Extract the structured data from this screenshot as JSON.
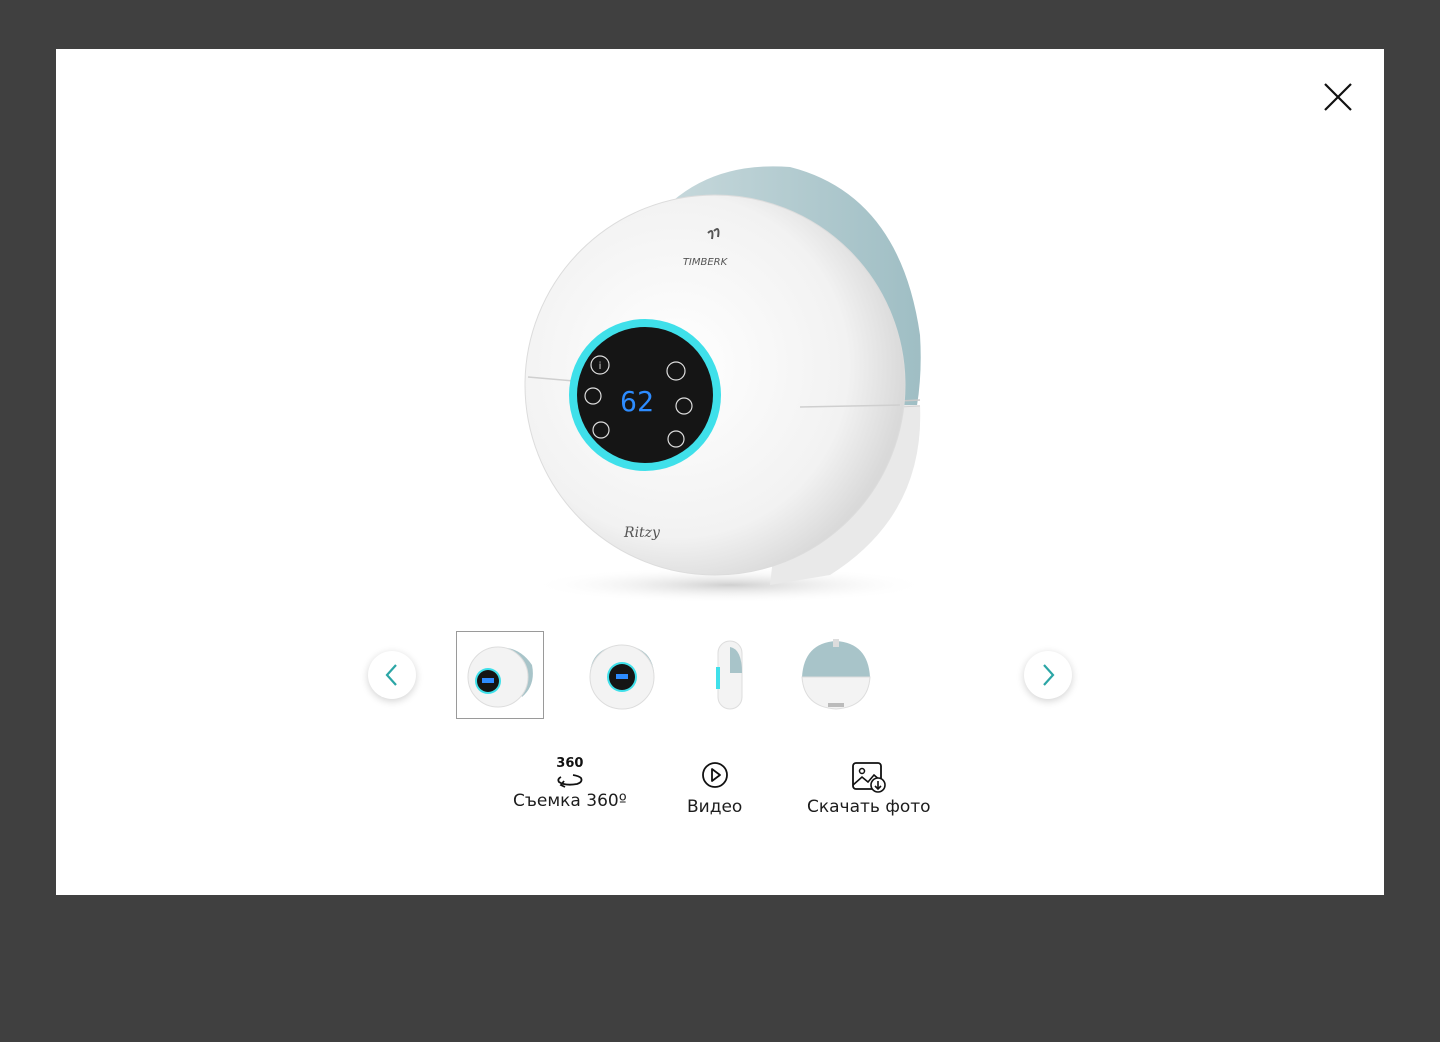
{
  "modal": {
    "close_icon": "close-icon",
    "product_image_alt": "humidifier-photo"
  },
  "navigation": {
    "prev_icon": "chevron-left-icon",
    "next_icon": "chevron-right-icon",
    "accent_color": "#2ba6a6"
  },
  "thumbnails": [
    {
      "view": "front-angle",
      "active": true
    },
    {
      "view": "front",
      "active": false
    },
    {
      "view": "side",
      "active": false
    },
    {
      "view": "back",
      "active": false
    }
  ],
  "display_reading": "62",
  "brand": "TIMBERK",
  "model_script": "Ritzy",
  "actions": {
    "spin_icon_text": "360",
    "spin_label": "Съемка 360º",
    "video_label": "Видео",
    "download_label": "Скачать фото"
  }
}
